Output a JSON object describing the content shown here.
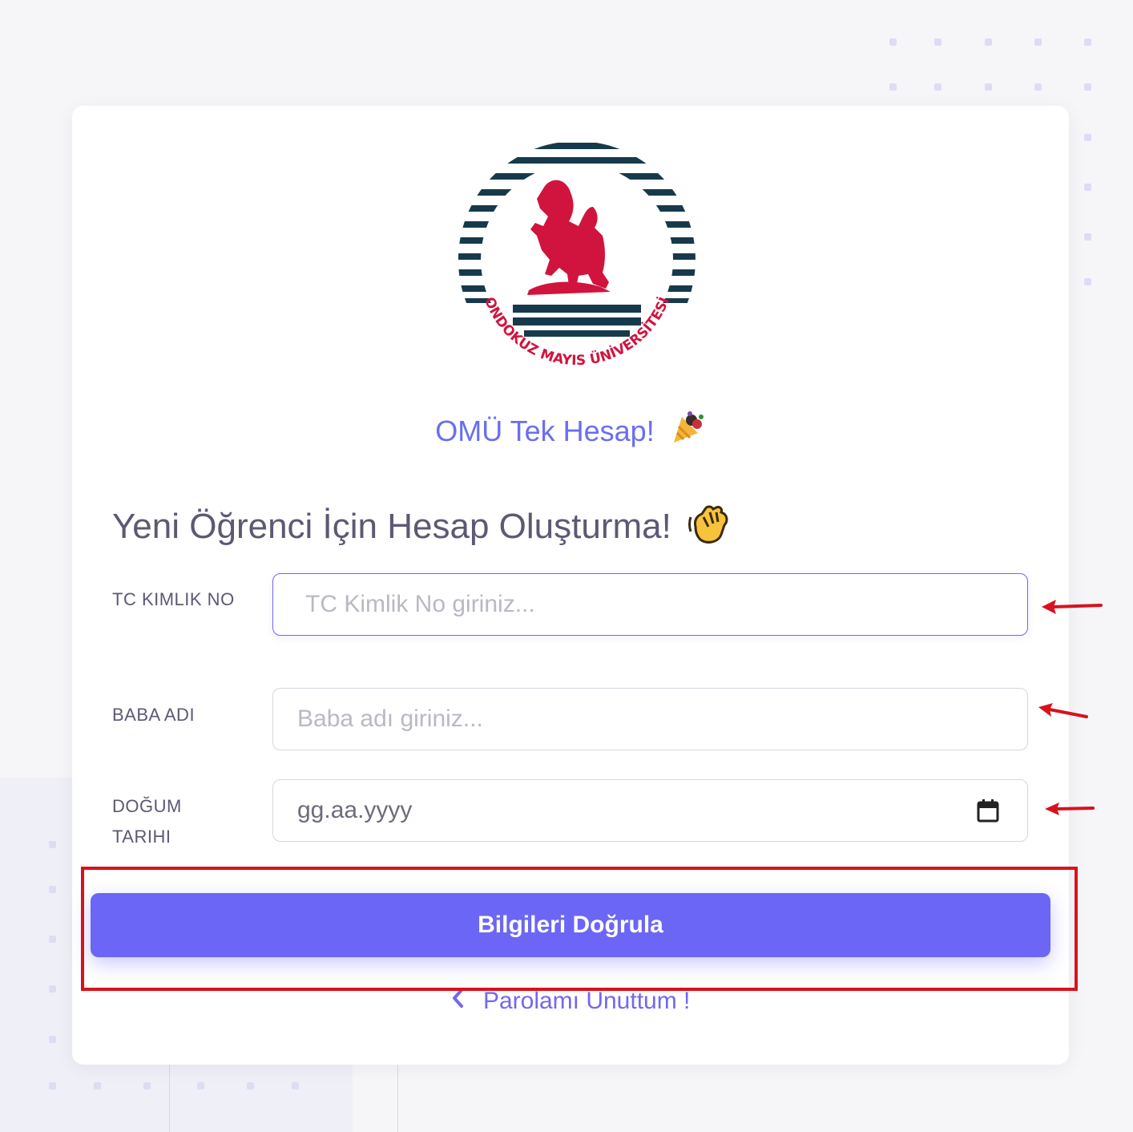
{
  "brand": {
    "title": "OMÜ Tek Hesap!",
    "emoji": "🎉"
  },
  "logo": {
    "text": "ONDOKUZ MAYIS ÜNİVERSİTESİ"
  },
  "form": {
    "heading": "Yeni Öğrenci İçin Hesap Oluşturma!",
    "heading_emoji": "👋",
    "tc": {
      "label": "TC KIMLIK NO",
      "placeholder": "TC Kimlik No giriniz..."
    },
    "father": {
      "label": "BABA ADI",
      "placeholder": "Baba adı giriniz..."
    },
    "birth": {
      "label": "DOĞUM TARIHI",
      "value": "gg.aa.yyyy"
    },
    "submit_label": "Bilgileri Doğrula",
    "forgot_label": "Parolamı Unuttum !"
  },
  "colors": {
    "accent": "#6b66f5",
    "annotation": "#d8121c",
    "logo_red": "#d0143e",
    "logo_navy": "#163a4c"
  }
}
